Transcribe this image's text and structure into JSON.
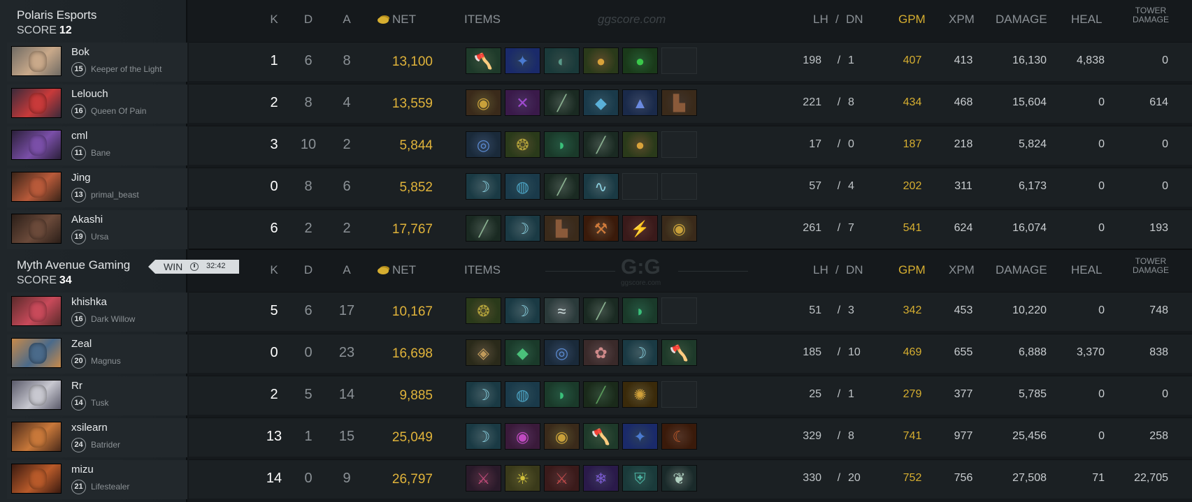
{
  "columns": {
    "k": "K",
    "d": "D",
    "a": "A",
    "net": "NET",
    "items": "ITEMS",
    "lh": "LH",
    "slash": "/",
    "dn": "DN",
    "gpm": "GPM",
    "xpm": "XPM",
    "damage": "DAMAGE",
    "heal": "HEAL",
    "tower_line1": "TOWER",
    "tower_line2": "DAMAGE"
  },
  "watermark_top": "ggscore.com",
  "watermark_mid": "G:G",
  "watermark_mid_sub": "ggscore.com",
  "result": {
    "label": "WIN",
    "duration": "32:42",
    "icon": "clock-icon"
  },
  "colors": {
    "gold": "#d6ae30",
    "net": "#e0b33a",
    "panel": "#22282c",
    "row": "#1b2023"
  },
  "teams": [
    {
      "name": "Polaris Esports",
      "score_label": "SCORE",
      "score": "12",
      "players": [
        {
          "name": "Bok",
          "level": "15",
          "hero": "Keeper of the Light",
          "k": "1",
          "d": "6",
          "a": "8",
          "net": "13,100",
          "lh": "198",
          "dn": "1",
          "gpm": "407",
          "xpm": "413",
          "damage": "16,130",
          "heal": "4,838",
          "tower": "0",
          "portrait": [
            "#c9a98a",
            "#6f6a63"
          ],
          "items": [
            "battle-fury",
            "aghanims-scepter",
            "tranquil-boots",
            "mango",
            "healing-salve",
            "empty"
          ]
        },
        {
          "name": "Lelouch",
          "level": "16",
          "hero": "Queen Of Pain",
          "k": "2",
          "d": "8",
          "a": "4",
          "net": "13,559",
          "lh": "221",
          "dn": "8",
          "gpm": "434",
          "xpm": "468",
          "damage": "15,604",
          "heal": "0",
          "tower": "614",
          "portrait": [
            "#c83a3a",
            "#3a2a3a"
          ],
          "items": [
            "wraith-band",
            "witch-blade",
            "mystic-staff",
            "bottle",
            "mana-potion",
            "boots"
          ]
        },
        {
          "name": "cml",
          "level": "11",
          "hero": "Bane",
          "k": "3",
          "d": "10",
          "a": "2",
          "net": "5,844",
          "lh": "17",
          "dn": "0",
          "gpm": "187",
          "xpm": "218",
          "damage": "5,824",
          "heal": "0",
          "tower": "0",
          "portrait": [
            "#7a4fa8",
            "#2b1f3a"
          ],
          "items": [
            "arcane-boots",
            "urn",
            "phase-boots",
            "staff",
            "mango",
            "empty"
          ]
        },
        {
          "name": "Jing",
          "level": "13",
          "hero": "primal_beast",
          "k": "0",
          "d": "8",
          "a": "6",
          "net": "5,852",
          "lh": "57",
          "dn": "4",
          "gpm": "202",
          "xpm": "311",
          "damage": "6,173",
          "heal": "0",
          "tower": "0",
          "portrait": [
            "#b85a3a",
            "#3a2418"
          ],
          "items": [
            "quelling-blade",
            "orb",
            "staff",
            "wind-lace",
            "empty",
            "empty"
          ]
        },
        {
          "name": "Akashi",
          "level": "19",
          "hero": "Ursa",
          "k": "6",
          "d": "2",
          "a": "2",
          "net": "17,767",
          "lh": "261",
          "dn": "7",
          "gpm": "541",
          "xpm": "624",
          "damage": "16,074",
          "heal": "0",
          "tower": "193",
          "portrait": [
            "#6b4a3a",
            "#2a1e18"
          ],
          "items": [
            "staff",
            "quelling-blade",
            "boots",
            "black-king-bar",
            "maelstrom",
            "wraith-band"
          ]
        }
      ]
    },
    {
      "name": "Myth Avenue Gaming",
      "score_label": "SCORE",
      "score": "34",
      "players": [
        {
          "name": "khishka",
          "level": "16",
          "hero": "Dark Willow",
          "k": "5",
          "d": "6",
          "a": "17",
          "net": "10,167",
          "lh": "51",
          "dn": "3",
          "gpm": "342",
          "xpm": "453",
          "damage": "10,220",
          "heal": "0",
          "tower": "748",
          "portrait": [
            "#c84a5a",
            "#5a2a2a"
          ],
          "items": [
            "urn",
            "quelling-blade",
            "eul-scepter",
            "staff",
            "phase-boots",
            "empty"
          ]
        },
        {
          "name": "Zeal",
          "level": "20",
          "hero": "Magnus",
          "k": "0",
          "d": "0",
          "a": "23",
          "net": "16,698",
          "lh": "185",
          "dn": "10",
          "gpm": "469",
          "xpm": "655",
          "damage": "6,888",
          "heal": "3,370",
          "tower": "838",
          "portrait": [
            "#4a6a8a",
            "#c88a4a"
          ],
          "items": [
            "blink-dagger",
            "shivas-guard",
            "arcane-boots",
            "refresher-orb",
            "quelling-blade",
            "battle-fury"
          ]
        },
        {
          "name": "Rr",
          "level": "14",
          "hero": "Tusk",
          "k": "2",
          "d": "5",
          "a": "14",
          "net": "9,885",
          "lh": "25",
          "dn": "1",
          "gpm": "279",
          "xpm": "377",
          "damage": "5,785",
          "heal": "0",
          "tower": "0",
          "portrait": [
            "#c8c8d0",
            "#5a5a6a"
          ],
          "items": [
            "quelling-blade",
            "orb",
            "phase-boots",
            "branch",
            "fairy-fire",
            "empty"
          ]
        },
        {
          "name": "xsilearn",
          "level": "24",
          "hero": "Batrider",
          "k": "13",
          "d": "1",
          "a": "15",
          "net": "25,049",
          "lh": "329",
          "dn": "8",
          "gpm": "741",
          "xpm": "977",
          "damage": "25,456",
          "heal": "0",
          "tower": "258",
          "portrait": [
            "#c8783a",
            "#4a2a1a"
          ],
          "items": [
            "quelling-blade",
            "orb-of-corrosion",
            "wraith-band",
            "battle-fury",
            "aghanims-scepter",
            "satanic"
          ]
        },
        {
          "name": "mizu",
          "level": "21",
          "hero": "Lifestealer",
          "k": "14",
          "d": "0",
          "a": "9",
          "net": "26,797",
          "lh": "330",
          "dn": "20",
          "gpm": "752",
          "xpm": "756",
          "damage": "27,508",
          "heal": "71",
          "tower": "22,705",
          "portrait": [
            "#b85a2a",
            "#3a1a10"
          ],
          "items": [
            "sange-yasha",
            "radiance",
            "desolator",
            "eye-of-skadi",
            "assault-cuirass",
            "butterfly"
          ]
        }
      ]
    }
  ]
}
